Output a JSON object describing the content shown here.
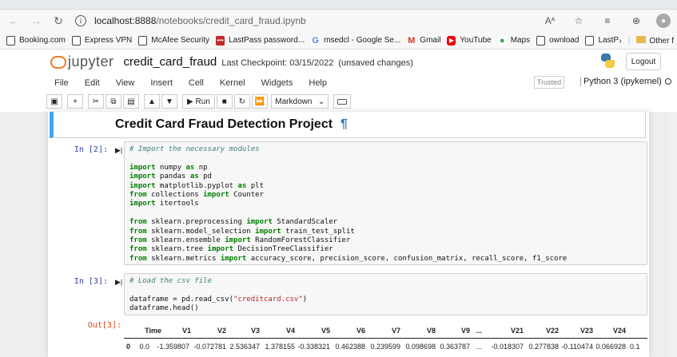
{
  "browser": {
    "url_host": "localhost:8888",
    "url_path": "/notebooks/credit_card_fraud.ipynb",
    "bookmarks": [
      {
        "label": "Booking.com",
        "icon": "page-icon"
      },
      {
        "label": "Express VPN",
        "icon": "page-icon"
      },
      {
        "label": "McAfee Security",
        "icon": "page-icon"
      },
      {
        "label": "LastPass password...",
        "icon": "lastpass-icon"
      },
      {
        "label": "msedcl - Google Se...",
        "icon": "google-icon"
      },
      {
        "label": "Gmail",
        "icon": "gmail-icon"
      },
      {
        "label": "YouTube",
        "icon": "youtube-icon"
      },
      {
        "label": "Maps",
        "icon": "maps-icon"
      },
      {
        "label": "ownload",
        "icon": "page-icon"
      },
      {
        "label": "LastPass",
        "icon": "page-icon"
      }
    ],
    "other_favorites": "Other f"
  },
  "jupyter": {
    "logo_text": "jupyter",
    "notebook_name": "credit_card_fraud",
    "checkpoint": "Last Checkpoint: 03/15/2022",
    "unsaved": "(unsaved changes)",
    "logout_label": "Logout",
    "menu": [
      "File",
      "Edit",
      "View",
      "Insert",
      "Cell",
      "Kernel",
      "Widgets",
      "Help"
    ],
    "trusted": "Trusted",
    "kernel_name": "Python 3 (ipykernel)",
    "toolbar": {
      "run_label": "Run",
      "cell_type": "Markdown"
    }
  },
  "cells": {
    "markdown_title": "Credit Card Fraud Detection Project",
    "pilcrow": "¶",
    "cell2": {
      "prompt": "In [2]:",
      "comment": "# Import the necessary modules",
      "imports": [
        [
          "import",
          " numpy ",
          "as",
          " np"
        ],
        [
          "import",
          " pandas ",
          "as",
          " pd"
        ],
        [
          "import",
          " matplotlib.pyplot ",
          "as",
          " plt"
        ],
        [
          "from",
          " collections ",
          "import",
          " Counter"
        ],
        [
          "import",
          " itertools",
          "",
          ""
        ]
      ],
      "sklearn": [
        [
          "from",
          " sklearn.preprocessing ",
          "import",
          " StandardScaler"
        ],
        [
          "from",
          " sklearn.model_selection ",
          "import",
          " train_test_split"
        ],
        [
          "from",
          " sklearn.ensemble ",
          "import",
          " RandomForestClassifier"
        ],
        [
          "from",
          " sklearn.tree ",
          "import",
          " DecisionTreeClassifier"
        ],
        [
          "from",
          " sklearn.metrics ",
          "import",
          " accuracy_score, precision_score, confusion_matrix, recall_score, f1_score"
        ]
      ]
    },
    "cell3": {
      "prompt": "In [3]:",
      "comment": "# Load the csv file",
      "line1_pre": "dataframe = pd.read_csv(",
      "line1_str": "\"creditcard.csv\"",
      "line1_post": ")",
      "line2": "dataframe.head()",
      "out_prompt": "Out[3]:"
    },
    "table": {
      "headers": [
        "",
        "Time",
        "V1",
        "V2",
        "V3",
        "V4",
        "V5",
        "V6",
        "V7",
        "V8",
        "V9",
        "...",
        "V21",
        "V22",
        "V23",
        "V24"
      ],
      "row0": [
        "0",
        "0.0",
        "-1.359807",
        "-0.072781",
        "2.536347",
        "1.378155",
        "-0.338321",
        "0.462388",
        "0.239599",
        "0.098698",
        "0.363787",
        "...",
        "-0.018307",
        "0.277838",
        "-0.110474",
        "0.066928",
        "0.1"
      ]
    }
  }
}
